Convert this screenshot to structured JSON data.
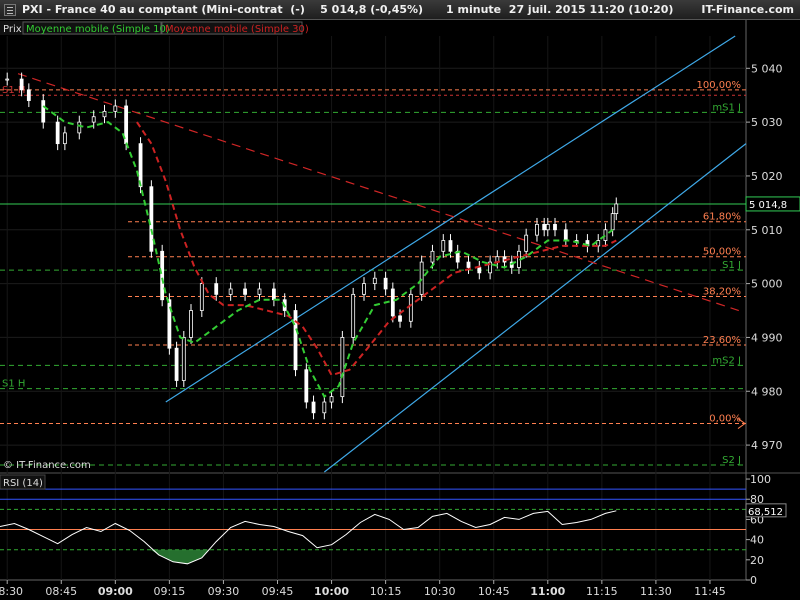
{
  "window": {
    "title": "PXI - France 40 au comptant (Mini-contrat  (-)    5 014,8 (-0,45%)      1 minute  27 juil. 2015 11:20 (10:20)",
    "brand": "IT-Finance.com"
  },
  "main_panel": {
    "legend_price": "Prix",
    "legend_ma10": "Moyenne mobile (Simple 10)",
    "legend_ma30": "Moyenne mobile (Simple 30)",
    "watermark": "© IT-Finance.com",
    "current_price_label": "5 014,8"
  },
  "rsi_panel": {
    "label": "RSI (14)",
    "value_label": "68,512"
  },
  "colors": {
    "background": "#000000",
    "candle": "#ffffff",
    "ma10": "#33cc33",
    "ma30": "#cc2222",
    "channel": "#3fa9e8",
    "fib": "#ff7f50",
    "pivot": "#33aa33",
    "rsi_line": "#ffffff"
  },
  "chart_data": [
    {
      "type": "candlestick",
      "title": "PXI - France 40 au comptant (Mini-contrat  (-)",
      "interval": "1 minute",
      "y_ticks": [
        "4 970",
        "4 980",
        "4 990",
        "5 000",
        "5 010",
        "5 020",
        "5 030",
        "5 040"
      ],
      "ylim": [
        4965,
        5046
      ],
      "x_ticks": [
        "08:30",
        "08:45",
        "09:00",
        "09:15",
        "09:30",
        "09:45",
        "10:00",
        "10:15",
        "10:30",
        "10:45",
        "11:00",
        "11:15",
        "11:30",
        "11:45"
      ],
      "xlim": [
        "08:28",
        "11:55"
      ],
      "close_series": {
        "x": [
          "08:30",
          "08:34",
          "08:36",
          "08:40",
          "08:44",
          "08:46",
          "08:50",
          "08:54",
          "08:57",
          "09:00",
          "09:03",
          "09:07",
          "09:10",
          "09:13",
          "09:15",
          "09:17",
          "09:19",
          "09:21",
          "09:24",
          "09:28",
          "09:32",
          "09:36",
          "09:40",
          "09:44",
          "09:47",
          "09:50",
          "09:53",
          "09:55",
          "09:58",
          "10:00",
          "10:03",
          "10:06",
          "10:09",
          "10:12",
          "10:15",
          "10:17",
          "10:19",
          "10:22",
          "10:25",
          "10:28",
          "10:31",
          "10:33",
          "10:35",
          "10:38",
          "10:41",
          "10:44",
          "10:46",
          "10:48",
          "10:50",
          "10:52",
          "10:54",
          "10:57",
          "10:59",
          "11:00",
          "11:02",
          "11:05",
          "11:08",
          "11:11",
          "11:14",
          "11:16",
          "11:18",
          "11:19"
        ],
        "close": [
          5038,
          5036,
          5034,
          5030,
          5026,
          5028,
          5030,
          5031,
          5032,
          5033,
          5026,
          5018,
          5006,
          4997,
          4988,
          4982,
          4990,
          4995,
          5000,
          4998,
          4999,
          4998,
          4999,
          4997,
          4995,
          4984,
          4978,
          4976,
          4978,
          4979,
          4990,
          4998,
          5000,
          5001,
          4999,
          4994,
          4993,
          4998,
          5004,
          5006,
          5008,
          5006,
          5004,
          5003,
          5002,
          5004,
          5005,
          5004,
          5003,
          5006,
          5009,
          5011,
          5010,
          5011,
          5010,
          5008,
          5008,
          5007,
          5008,
          5010,
          5013,
          5014.8
        ]
      },
      "ma10": {
        "x": [
          "08:40",
          "08:46",
          "08:52",
          "08:58",
          "09:02",
          "09:06",
          "09:10",
          "09:14",
          "09:18",
          "09:22",
          "09:28",
          "09:34",
          "09:40",
          "09:46",
          "09:50",
          "09:54",
          "09:58",
          "10:02",
          "10:06",
          "10:12",
          "10:18",
          "10:24",
          "10:30",
          "10:36",
          "10:42",
          "10:48",
          "10:54",
          "11:00",
          "11:06",
          "11:12",
          "11:18"
        ],
        "y": [
          5033,
          5030,
          5029,
          5030,
          5028,
          5021,
          5010,
          4998,
          4990,
          4989,
          4992,
          4995,
          4997,
          4997,
          4992,
          4984,
          4979,
          4981,
          4989,
          4996,
          4997,
          5000,
          5005,
          5006,
          5004,
          5003,
          5005,
          5008,
          5008,
          5007,
          5010
        ]
      },
      "ma30": {
        "x": [
          "09:06",
          "09:10",
          "09:14",
          "09:18",
          "09:22",
          "09:26",
          "09:30",
          "09:36",
          "09:42",
          "09:48",
          "09:52",
          "09:56",
          "10:00",
          "10:05",
          "10:10",
          "10:16",
          "10:22",
          "10:28",
          "10:34",
          "10:40",
          "10:46",
          "10:52",
          "10:58",
          "11:04",
          "11:10",
          "11:16",
          "11:19"
        ],
        "y": [
          5030,
          5026,
          5019,
          5010,
          5003,
          4998,
          4996,
          4996,
          4995,
          4994,
          4992,
          4988,
          4983,
          4984,
          4988,
          4993,
          4996,
          4999,
          5002,
          5003,
          5004,
          5005,
          5006,
          5007,
          5007,
          5007,
          5008
        ]
      },
      "horizontal_levels": [
        {
          "label": "100,00%",
          "value": 5036,
          "style": "fib"
        },
        {
          "label": "61,80%",
          "value": 5011.5,
          "style": "fib"
        },
        {
          "label": "50,00%",
          "value": 5005,
          "style": "fib"
        },
        {
          "label": "38,20%",
          "value": 4997.6,
          "style": "fib"
        },
        {
          "label": "23,60%",
          "value": 4988.6,
          "style": "fib"
        },
        {
          "label": "0,00%",
          "value": 4974,
          "style": "fib"
        },
        {
          "label": "S1 H",
          "value": 5035,
          "style": "support_h"
        },
        {
          "label": "",
          "value": 5014.8,
          "style": "last_price"
        },
        {
          "label": "mS1 J",
          "value": 5031.8,
          "style": "pivot"
        },
        {
          "label": "S1 J",
          "value": 5002.5,
          "style": "pivot"
        },
        {
          "label": "mS2 J",
          "value": 4984.8,
          "style": "pivot"
        },
        {
          "label": "S1 H",
          "value": 4980.5,
          "style": "pivot"
        },
        {
          "label": "S2 J",
          "value": 4966.3,
          "style": "pivot"
        }
      ],
      "trend_lines": [
        {
          "name": "channel_upper",
          "from": [
            "09:14",
            4978
          ],
          "to": [
            "11:52",
            5046
          ]
        },
        {
          "name": "channel_lower",
          "from": [
            "09:58",
            4965
          ],
          "to": [
            "11:55",
            5026
          ]
        },
        {
          "name": "resistance_dashed",
          "from": [
            "08:33",
            5039
          ],
          "to": [
            "11:53",
            4995
          ]
        }
      ]
    },
    {
      "type": "line",
      "title": "RSI (14)",
      "y_ticks": [
        "0",
        "20",
        "40",
        "60",
        "80",
        "100"
      ],
      "ylim": [
        0,
        105
      ],
      "levels": [
        30,
        50,
        70,
        80,
        90
      ],
      "x": [
        "08:28",
        "08:32",
        "08:36",
        "08:40",
        "08:44",
        "08:48",
        "08:52",
        "08:56",
        "09:00",
        "09:04",
        "09:08",
        "09:12",
        "09:16",
        "09:20",
        "09:24",
        "09:28",
        "09:32",
        "09:36",
        "09:40",
        "09:44",
        "09:48",
        "09:52",
        "09:56",
        "10:00",
        "10:04",
        "10:08",
        "10:12",
        "10:16",
        "10:20",
        "10:24",
        "10:28",
        "10:32",
        "10:36",
        "10:40",
        "10:44",
        "10:48",
        "10:52",
        "10:56",
        "11:00",
        "11:04",
        "11:08",
        "11:12",
        "11:16",
        "11:19"
      ],
      "y": [
        53,
        56,
        50,
        43,
        36,
        45,
        52,
        48,
        56,
        49,
        38,
        25,
        18,
        16,
        22,
        38,
        52,
        58,
        55,
        53,
        48,
        44,
        32,
        35,
        45,
        57,
        65,
        60,
        50,
        52,
        63,
        66,
        58,
        52,
        55,
        62,
        60,
        66,
        68,
        55,
        57,
        60,
        66,
        68.5
      ]
    }
  ]
}
